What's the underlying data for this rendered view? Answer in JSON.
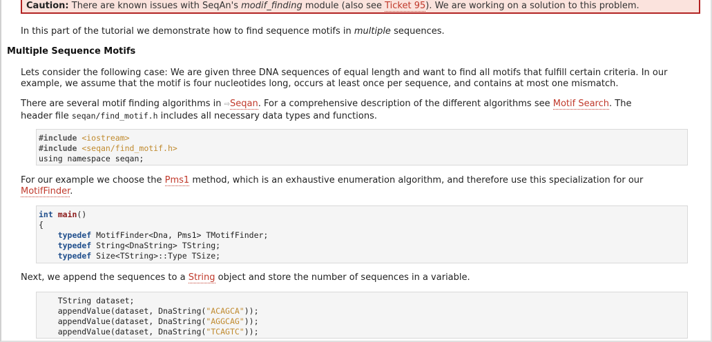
{
  "caution": {
    "label": "Caution:",
    "text1": " There are known issues with SeqAn's ",
    "module": "modif_finding",
    "text2": " module (also see ",
    "ticket_link": "Ticket 95",
    "text3": "). We are working on a solution to this problem."
  },
  "intro": {
    "text1": "In this part of the tutorial we demonstrate how to find sequence motifs in ",
    "emph": "multiple",
    "text2": " sequences."
  },
  "section_title": "Multiple Sequence Motifs",
  "para1": "Lets consider the following case: We are given three DNA sequences of equal length and want to find all motifs that fulfill certain criteria. In our example, we assume that the motif is four nucleotides long, occurs at least once per sequence, and contains at most one mismatch.",
  "para2": {
    "text1": "There are several motif finding algorithms in ",
    "seqan_link": "Seqan",
    "text2": ". For a comprehensive description of the different algorithms see ",
    "motif_link": "Motif Search",
    "text3": ". The",
    "text4": "header file ",
    "header_file": "seqan/find_motif.h",
    "text5": " includes all necessary data types and functions."
  },
  "code1": {
    "line1_pp": "#include",
    "line1_inc": " <iostream>",
    "line2_pp": "#include",
    "line2_inc": " <seqan/find_motif.h>",
    "line3": "using namespace seqan;"
  },
  "para3": {
    "text1": "For our example we choose the ",
    "pms1_link": "Pms1",
    "text2": " method, which is an exhaustive enumeration algorithm, and therefore use this specialization for our",
    "motiffinder_link": "MotifFinder",
    "text3": "."
  },
  "code2": {
    "l1_kw": "int",
    "l1_fn": "main",
    "l1_rest": "()",
    "l2": "{",
    "td": "typedef",
    "l3": " MotifFinder<Dna, Pms1> TMotifFinder;",
    "l4": " String<DnaString> TString;",
    "l5": " Size<TString>::Type TSize;"
  },
  "para4": {
    "text1": "Next, we append the sequences to a ",
    "string_link": "String",
    "text2": " object and store the number of sequences in a variable."
  },
  "code3": {
    "l1": "    TString dataset;",
    "call": "    appendValue(dataset, DnaString(",
    "s1": "\"ACAGCA\"",
    "s2": "\"AGGCAG\"",
    "s3": "\"TCAGTC\"",
    "end": "));"
  }
}
